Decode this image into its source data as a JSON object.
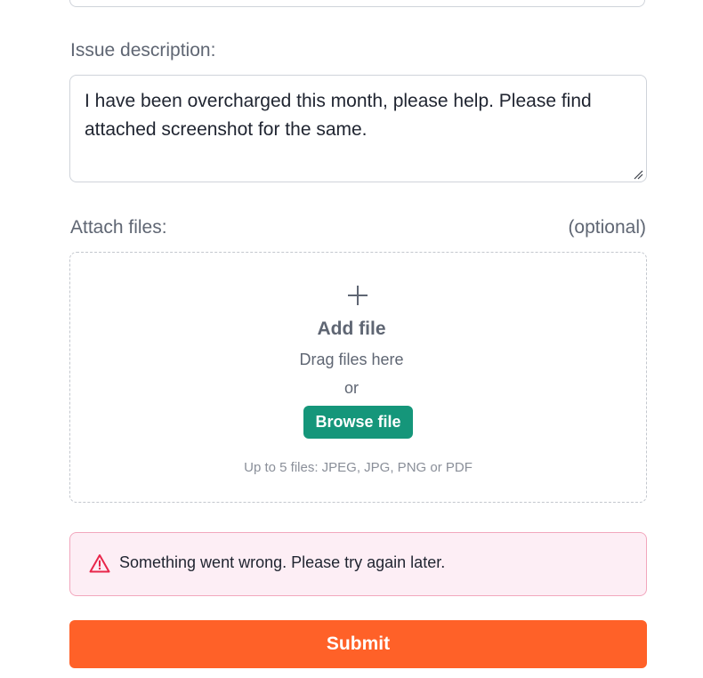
{
  "form": {
    "description": {
      "label": "Issue description:",
      "value": "I have been overcharged this month, please help. Please find attached screenshot for the same."
    },
    "attachments": {
      "label": "Attach files:",
      "optional_label": "(optional)",
      "add_file_label": "Add file",
      "drag_text": "Drag files here",
      "or_text": "or",
      "browse_label": "Browse file",
      "hint": "Up to 5 files: JPEG, JPG, PNG or PDF"
    },
    "error": {
      "message": "Something went wrong. Please try again later."
    },
    "submit_label": "Submit"
  },
  "colors": {
    "browse_button": "#15967a",
    "submit_button": "#ff6128",
    "error_background": "#fdeef5",
    "error_border": "#f2a7bd",
    "error_icon": "#e8264a"
  },
  "icons": {
    "plus": "plus-icon",
    "warning": "warning-icon",
    "resize": "resize-handle-icon"
  }
}
